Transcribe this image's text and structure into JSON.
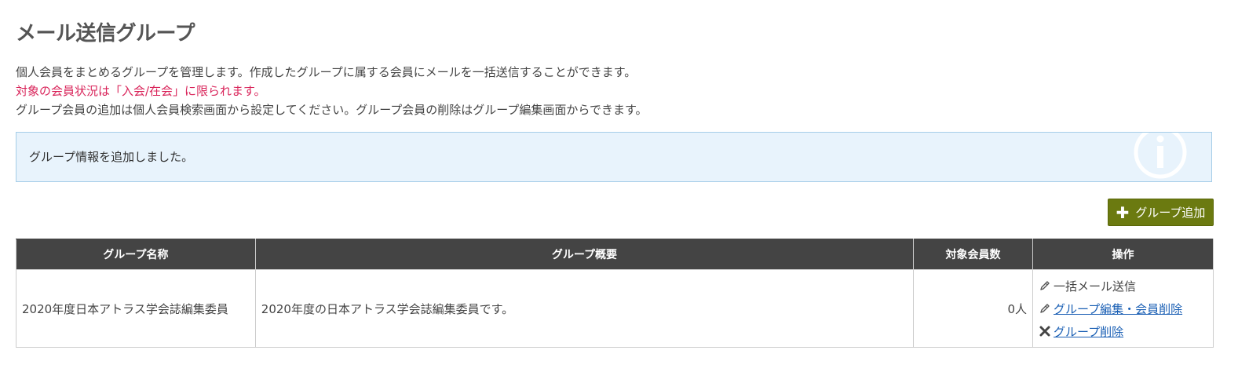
{
  "page": {
    "title": "メール送信グループ",
    "description": {
      "line1": "個人会員をまとめるグループを管理します。作成したグループに属する会員にメールを一括送信することができます。",
      "line2": "対象の会員状況は「入会/在会」に限られます。",
      "line3": "グループ会員の追加は個人会員検索画面から設定してください。グループ会員の削除はグループ編集画面からできます。"
    }
  },
  "alert": {
    "message": "グループ情報を追加しました。",
    "icon": "info-icon"
  },
  "toolbar": {
    "add_label": "グループ追加",
    "add_icon": "plus-icon"
  },
  "table": {
    "headers": [
      "グループ名称",
      "グループ概要",
      "対象会員数",
      "操作"
    ],
    "rows": [
      {
        "name": "2020年度日本アトラス学会誌編集委員",
        "summary": "2020年度の日本アトラス学会誌編集委員です。",
        "count": "0人",
        "actions": {
          "bulk_mail": "一括メール送信",
          "edit": "グループ編集・会員削除",
          "delete": "グループ削除"
        }
      }
    ]
  },
  "colors": {
    "title": "#555555",
    "warning_text": "#d9245a",
    "alert_bg": "#e8f3fc",
    "alert_border": "#a6cde8",
    "add_button": "#6b7a10",
    "table_header": "#444444",
    "link": "#1a5fb4"
  }
}
